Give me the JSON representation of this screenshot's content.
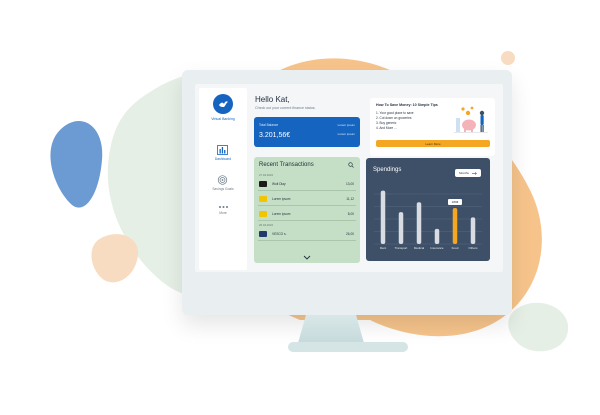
{
  "app": {
    "logo_text": "Virtual Banking"
  },
  "sidebar": {
    "items": [
      {
        "label": "Dashboard",
        "icon": "bar-chart-icon",
        "active": true
      },
      {
        "label": "Savings Goals",
        "icon": "target-icon",
        "active": false
      },
      {
        "label": "More",
        "icon": "more-dots-icon",
        "active": false
      }
    ]
  },
  "greeting": {
    "title": "Hello Kat,",
    "subtitle": "Check out your current finance status."
  },
  "balance": {
    "label": "Total Balance",
    "value": "3.201,56€",
    "link_top": "Lorem ipsum",
    "link_bottom": "Lorem ipsum"
  },
  "transactions": {
    "title": "Recent Transactions",
    "sections": [
      {
        "label": "27.04.2022",
        "rows": [
          {
            "name": "Wolt Dlay",
            "amount": "13,00",
            "color": "#1b1b1b"
          },
          {
            "name": "Lorem ipsum",
            "amount": "11,12",
            "color": "#f2c500"
          },
          {
            "name": "Lorem ipsum",
            "amount": "8,00",
            "color": "#f2c500"
          }
        ]
      },
      {
        "label": "26.04.2022",
        "rows": [
          {
            "name": "VESCO s.",
            "amount": "26,00",
            "color": "#1f3b6e"
          }
        ]
      }
    ]
  },
  "tips": {
    "title": "How To Save Money: 10 Simple Tips",
    "items": [
      "1. Your good place to save",
      "2. Cut down on groceries",
      "3. Buy generic",
      "4. And More ..."
    ],
    "button_label": "Learn More"
  },
  "spendings": {
    "title": "Spendings",
    "filter_label": "Months",
    "highlight_label": "180€"
  },
  "chart_data": {
    "type": "bar",
    "categories": [
      "Rent",
      "Transport",
      "Medical",
      "Insurance",
      "Food",
      "Others"
    ],
    "values": [
      0.92,
      0.55,
      0.72,
      0.26,
      0.62,
      0.46
    ],
    "highlight_index": 4,
    "bar_color": "#d9dde3",
    "highlight_color": "#f5a623"
  },
  "colors": {
    "accent_blue": "#1565c0",
    "transactions_bg": "#c5dfc6",
    "spendings_bg": "#3d5068",
    "highlight_orange": "#f5a623"
  }
}
